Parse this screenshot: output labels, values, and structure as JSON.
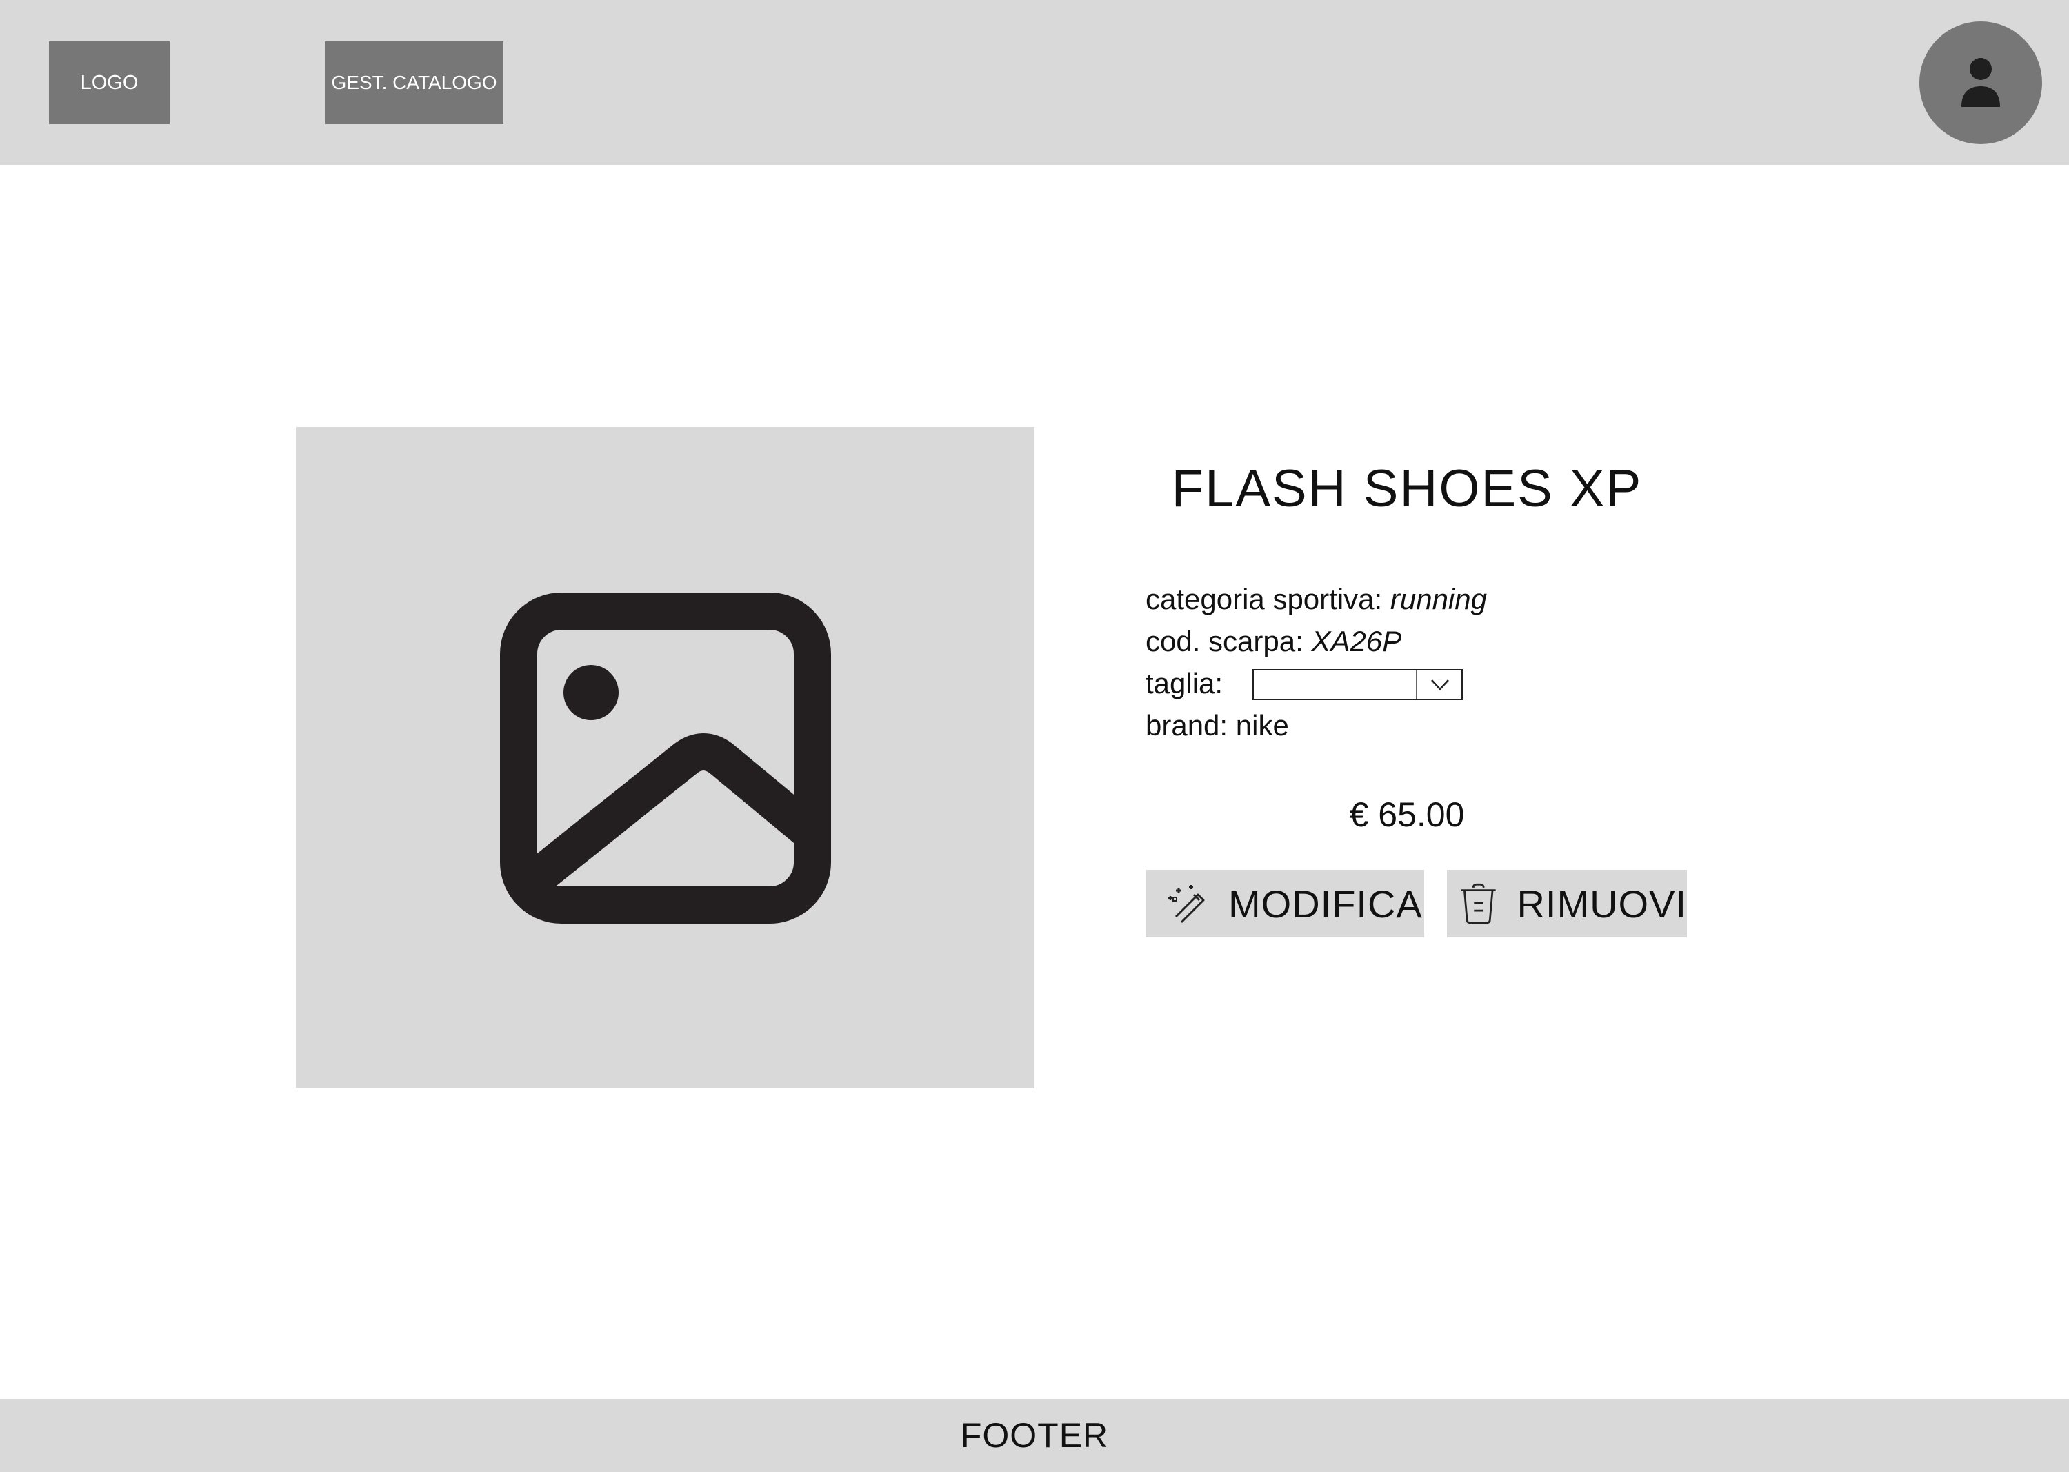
{
  "header": {
    "logo_label": "LOGO",
    "catalog_label": "GEST. CATALOGO",
    "avatar_icon": "user-icon"
  },
  "product": {
    "image_icon": "image-placeholder-icon",
    "title": "FLASH SHOES XP",
    "category_label": "categoria sportiva:",
    "category_value": "running",
    "code_label": "cod. scarpa:",
    "code_value": "XA26P",
    "size_label": "taglia:",
    "size_value": "",
    "brand_text": "brand: nike",
    "price": "€ 65.00"
  },
  "actions": {
    "edit_label": "MODIFICA",
    "edit_icon": "magic-wand-icon",
    "remove_label": "RIMUOVI",
    "remove_icon": "trash-icon"
  },
  "footer": {
    "label": "FOOTER"
  },
  "colors": {
    "header_bg": "#d9d9d9",
    "box_bg": "#777777",
    "icon_dark": "#231f20"
  }
}
